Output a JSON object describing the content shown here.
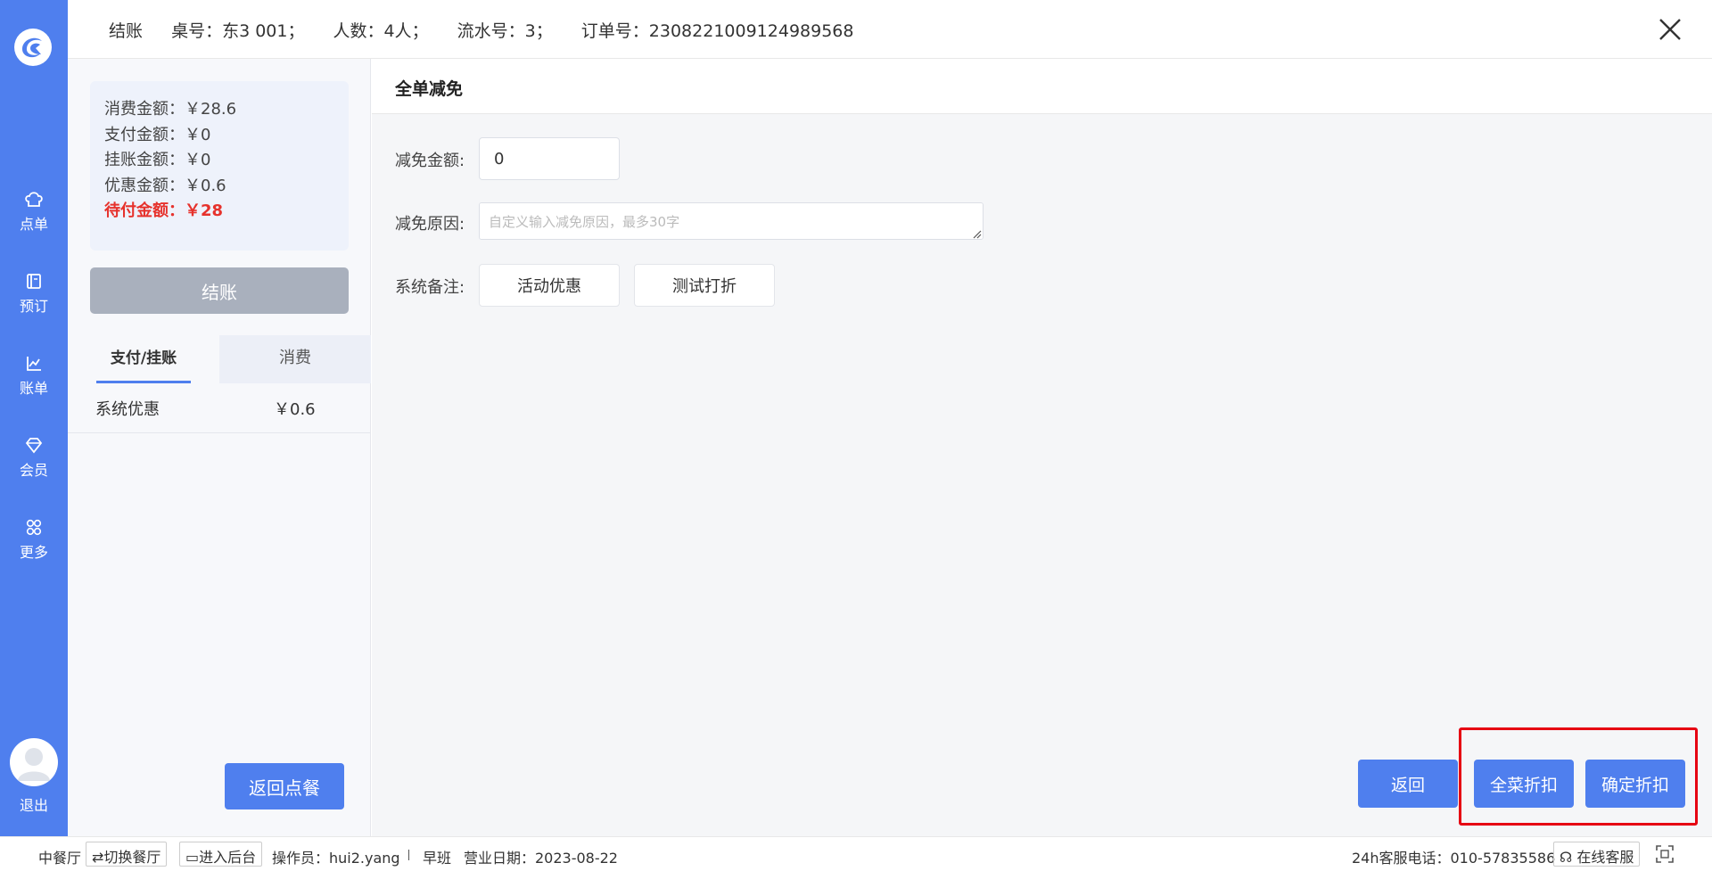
{
  "header": {
    "title": "结账",
    "table": "桌号：东3 001；",
    "guests": "人数：4人；",
    "serial": "流水号：3；",
    "order": "订单号：230822100912498956​8"
  },
  "nav": {
    "items": [
      {
        "label": "点单",
        "icon": "chef-hat-icon"
      },
      {
        "label": "预订",
        "icon": "book-icon"
      },
      {
        "label": "账单",
        "icon": "chart-icon"
      },
      {
        "label": "会员",
        "icon": "diamond-icon"
      },
      {
        "label": "更多",
        "icon": "grid-icon"
      }
    ],
    "logout": "退出"
  },
  "summary": {
    "consumption": "消费金额：￥28.6",
    "paid": "支付金额：￥0",
    "credit": "挂账金额：￥0",
    "discount": "优惠金额：￥0.6",
    "due": "待付金额：￥28"
  },
  "checkout_label": "结账",
  "tabs": {
    "payment": "支付/挂账",
    "consumption": "消费"
  },
  "list": {
    "name": "系统优惠",
    "amount": "￥0.6"
  },
  "back_order_label": "返回点餐",
  "panel": {
    "title": "全单减免",
    "amount_label": "减免金额:",
    "amount_value": "0",
    "reason_label": "减免原因:",
    "reason_placeholder": "自定义输入减免原因，最多30字",
    "remark_label": "系统备注:",
    "remark_options": [
      "活动优惠",
      "测试打折"
    ]
  },
  "actions": {
    "back": "返回",
    "all_discount": "全菜折扣",
    "confirm_discount": "确定折扣"
  },
  "footer": {
    "restaurant": "中餐厅",
    "switch": "切换餐厅",
    "backend": "进入后台",
    "operator": "操作员：hui2.yang",
    "shift": "早班",
    "business_date": "营业日期：2023-08-22",
    "hotline": "24h客服电话：010-57835586",
    "online_service": "在线客服"
  },
  "colors": {
    "primary": "#4f7fee",
    "due": "#e6322c",
    "highlight": "#e60012"
  }
}
